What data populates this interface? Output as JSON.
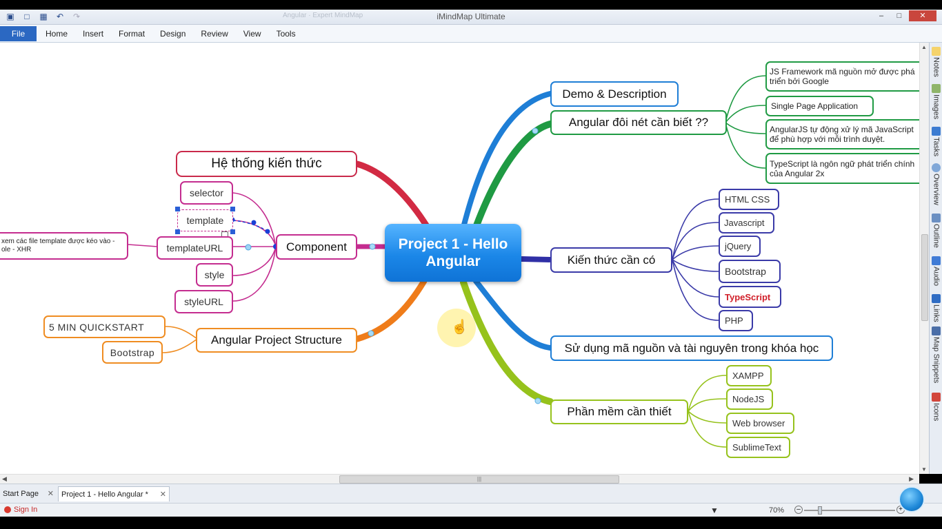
{
  "window": {
    "title": "iMindMap Ultimate",
    "ghost_tab": "Angular  ·  Expert MindMap"
  },
  "ribbon": {
    "file": "File",
    "menu": [
      "Home",
      "Insert",
      "Format",
      "Design",
      "Review",
      "View",
      "Tools"
    ]
  },
  "map": {
    "central": "Project 1 - Hello Angular",
    "left": {
      "he_thong": "Hệ thống kiến thức",
      "component": "Component",
      "component_children": [
        "selector",
        "template",
        "templateURL",
        "style",
        "styleURL"
      ],
      "templateurl_note_line1": "xem các file template được kéo vào -",
      "templateurl_note_line2": "ole - XHR",
      "structure": "Angular Project Structure",
      "structure_children": [
        "5 MIN QUICKSTART",
        "Bootstrap"
      ]
    },
    "right": {
      "demo": "Demo & Description",
      "angular_notes": "Angular đôi nét cần biết ??",
      "angular_children": [
        [
          "JS Framework mã nguồn mở được phá",
          "triển bởi Google"
        ],
        [
          "Single Page Application"
        ],
        [
          "AngularJS tự động xử lý mã JavaScript",
          "để phù hợp với mỗi trình duyệt."
        ],
        [
          "TypeScript là ngôn ngữ phát triển chính",
          "của Angular 2x"
        ]
      ],
      "kien_thuc": "Kiến thức cần có",
      "kien_thuc_children": [
        "HTML CSS",
        "Javascript",
        "jQuery",
        "Bootstrap",
        "TypeScript",
        "PHP"
      ],
      "su_dung": "Sử dụng mã nguồn và tài nguyên trong khóa học",
      "phan_mem": "Phần mềm cần thiết",
      "phan_mem_children": [
        "XAMPP",
        "NodeJS",
        "Web browser",
        "SublimeText"
      ]
    }
  },
  "side_panel": [
    "Notes",
    "Images",
    "Tasks",
    "Overview",
    "Outline",
    "Audio",
    "Links",
    "Map Snippets",
    "Icons"
  ],
  "doc_tabs": {
    "start": "Start Page",
    "project": "Project 1 - Hello Angular *"
  },
  "status": {
    "sign_in": "Sign In",
    "zoom": "70%"
  },
  "colors": {
    "red": "#c9294a",
    "pink": "#c42c8f",
    "orange": "#ef8c21",
    "blue": "#1e7ed6",
    "green": "#1f9a43",
    "navy": "#3a3aa8",
    "lime": "#96c21c",
    "central": "#1b87e8"
  }
}
